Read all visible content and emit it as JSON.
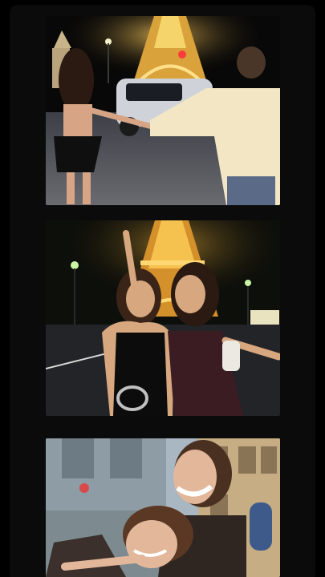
{
  "app": {
    "background_color": "#000000",
    "strip_color": "#0b0b0b"
  },
  "photos": [
    {
      "id": "photo-1",
      "description_icon": "photo-eiffel-tower-night-street",
      "palette": {
        "sky": "#0a0a0a",
        "tower": "#e8b84a",
        "ground": "#5a5c66",
        "shirt": "#f2e6c4",
        "dress": "#111111"
      }
    },
    {
      "id": "photo-2",
      "description_icon": "photo-two-women-eiffel-tower",
      "palette": {
        "sky": "#0d0f0b",
        "tower": "#f0b33a",
        "road": "#232428",
        "dress_left": "#0c0c0c",
        "dress_right": "#3a1c22",
        "skin": "#d7a77f",
        "hair": "#3a2418"
      }
    },
    {
      "id": "photo-3",
      "description_icon": "photo-friends-hugging-street",
      "palette": {
        "sky": "#a9b7c3",
        "building_left": "#8e9ca5",
        "building_right": "#c6ad83",
        "jacket": "#2f2622",
        "skin": "#e2b79a",
        "hair": "#5a3824"
      }
    }
  ]
}
